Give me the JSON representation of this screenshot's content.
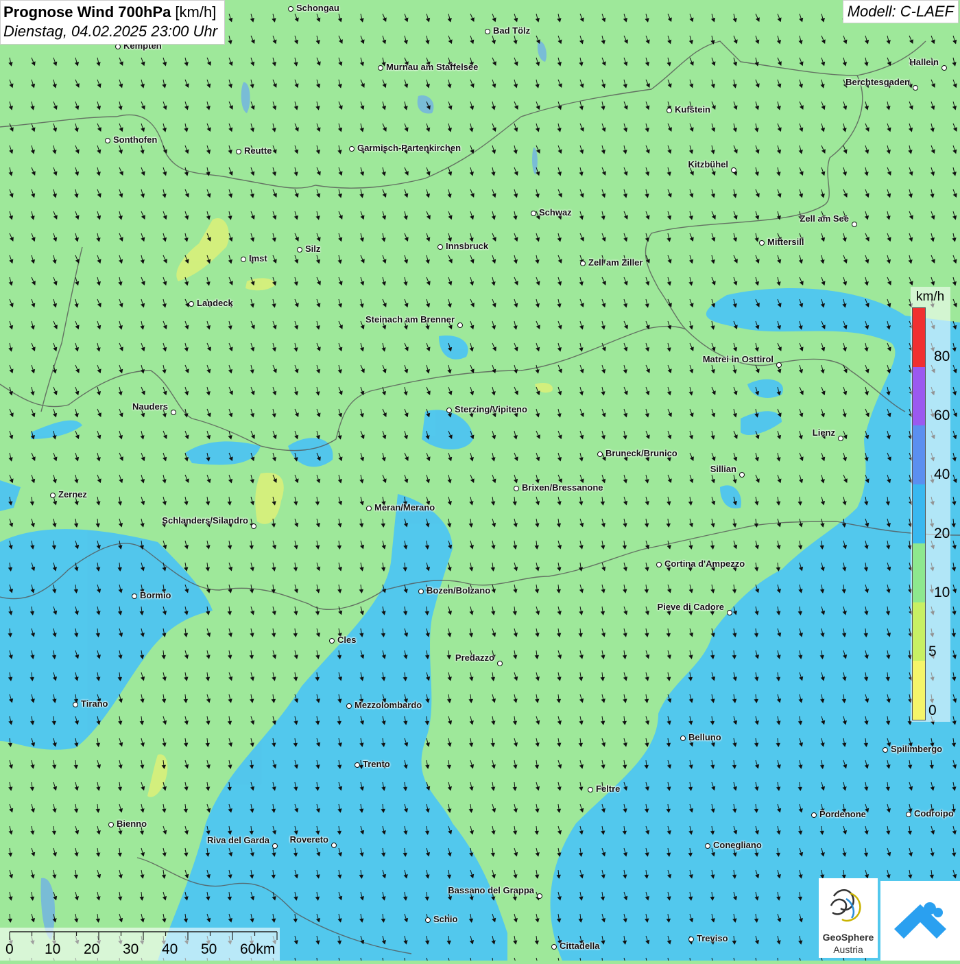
{
  "header": {
    "title_bold": "Prognose Wind 700hPa",
    "title_unit": " [km/h]",
    "datetime": "Dienstag, 04.02.2025 23:00 Uhr",
    "model": "Modell: C-LAEF"
  },
  "legend": {
    "unit": "km/h",
    "ticks": [
      "80",
      "60",
      "40",
      "20",
      "10",
      "5",
      "0"
    ],
    "colors": [
      "#f03030",
      "#9b59f0",
      "#5b8ff0",
      "#39b8f0",
      "#8ee88e",
      "#c8f064",
      "#f5f56a"
    ]
  },
  "scalebar": {
    "labels": [
      "0",
      "10",
      "20",
      "30",
      "40",
      "50",
      "60km"
    ]
  },
  "logo": {
    "name_line1": "GeoSphere",
    "name_line2": "Austria"
  },
  "colors": {
    "land_wind_10_20": "#9ee89a",
    "wind_20_40": "#4cc4f4",
    "wind_5_10": "#d8f07a",
    "water": "#6aaaf0"
  },
  "cities": [
    {
      "name": "Schongau"
    },
    {
      "name": "Bad Tölz"
    },
    {
      "name": "Kempten"
    },
    {
      "name": "Murnau am Staffelsee"
    },
    {
      "name": "Hallein"
    },
    {
      "name": "Berchtesgaden"
    },
    {
      "name": "Kufstein"
    },
    {
      "name": "Sonthofen"
    },
    {
      "name": "Reutte"
    },
    {
      "name": "Garmisch-Partenkirchen"
    },
    {
      "name": "Kitzbühel"
    },
    {
      "name": "Schwaz"
    },
    {
      "name": "Zell am See"
    },
    {
      "name": "Mittersill"
    },
    {
      "name": "Silz"
    },
    {
      "name": "Innsbruck"
    },
    {
      "name": "Imst"
    },
    {
      "name": "Zell am Ziller"
    },
    {
      "name": "Landeck"
    },
    {
      "name": "Steinach am Brenner"
    },
    {
      "name": "Matrei in Osttirol"
    },
    {
      "name": "Nauders"
    },
    {
      "name": "Sterzing/Vipiteno"
    },
    {
      "name": "Lienz"
    },
    {
      "name": "Bruneck/Brunico"
    },
    {
      "name": "Sillian"
    },
    {
      "name": "Zernez"
    },
    {
      "name": "Brixen/Bressanone"
    },
    {
      "name": "Meran/Merano"
    },
    {
      "name": "Schlanders/Silandro"
    },
    {
      "name": "Cortina d'Ampezzo"
    },
    {
      "name": "Bozen/Bolzano"
    },
    {
      "name": "Bormio"
    },
    {
      "name": "Pieve di Cadore"
    },
    {
      "name": "Cles"
    },
    {
      "name": "Predazzo"
    },
    {
      "name": "Tirano"
    },
    {
      "name": "Mezzolombardo"
    },
    {
      "name": "Belluno"
    },
    {
      "name": "Spilimbergo"
    },
    {
      "name": "Trento"
    },
    {
      "name": "Feltre"
    },
    {
      "name": "Pordenone"
    },
    {
      "name": "Codroipo"
    },
    {
      "name": "Bienno"
    },
    {
      "name": "Riva del Garda"
    },
    {
      "name": "Rovereto"
    },
    {
      "name": "Conegliano"
    },
    {
      "name": "Bassano del Grappa"
    },
    {
      "name": "Schio"
    },
    {
      "name": "Treviso"
    },
    {
      "name": "Cittadella"
    }
  ]
}
